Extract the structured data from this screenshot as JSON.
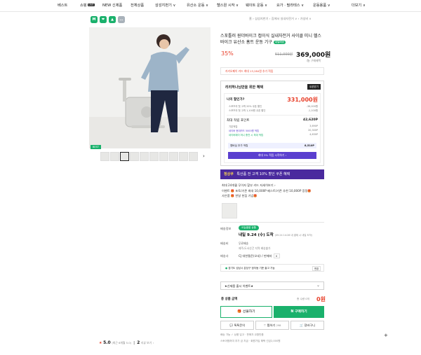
{
  "nav": {
    "items": [
      "베스트",
      "쇼핑",
      "NEW 신제품",
      "전체상품",
      "삼성지펀기 ∨",
      "유산소 운동 ∨",
      "헬스원 시작 ∨",
      "근력 운동 ∨",
      "웨이트 운동 ∨",
      "요가 · 필라테스 ∨",
      "운동용품 ∨",
      "더보기 ∨"
    ],
    "live_badge": "LIVE"
  },
  "breadcrumb": "홈 › 삼성지펀기 › 집에서 실내자전거 ∨ › 가성비 ∨",
  "badges": [
    "M",
    "❤",
    "▲",
    "…"
  ],
  "main_image": {
    "alt": "product photo"
  },
  "best_tag": "BEST",
  "thumbnails": {
    "count": 10,
    "selected_index": 2,
    "next": "›"
  },
  "rating": {
    "score": "5.0",
    "score_note": "(최근 6개월 5.0)",
    "reviews": "2",
    "reviews_label": "리뷰 보기"
  },
  "product": {
    "title": "스포틀러 원더바이크 접이식 실내자전거 사이클 미니 헬스 바이크 유산소 홈트 운동 기구",
    "delivery_badge": "내일배송",
    "discount": "35%",
    "orig_price": "511,000원",
    "price": "369,000원",
    "price_sub": "🛍 구매혜택",
    "card_line": "카카오페이 카드 최대 13,284원 추가 적립"
  },
  "benefit": {
    "header": "리리하나님만을 위한 혜택",
    "coupon_btn": "쿠폰받기",
    "mybest_label": "나의 할인가?",
    "mybest_value": "331,000원",
    "mybest_rows": [
      {
        "label": "스포츠의 첫 고객 20% 쿠폰 할인",
        "value": "-36,000원"
      },
      {
        "label": "스포츠의 첫 고객 1,100원 쿠폰 할인",
        "value": "-1,100원"
      }
    ],
    "points_label": "최대 적립 포인트",
    "points_value": "42,620P",
    "points_rows": [
      {
        "label": "기본적립",
        "value": "3,690P"
      },
      {
        "label": "네이버 현대카드 5000원 적립",
        "value": "20,300P"
      },
      {
        "label": "네이버페이 머니 충전 시 최대 적립",
        "value": "4,630P"
      }
    ],
    "membership": "멤버십 추가 적립",
    "membership_value": "8,510P",
    "cta": "최대 3% 적립 시작하기 ›"
  },
  "promo": {
    "accent": "정상쿠",
    "text": "특산품 전 고객 10% 할인 쿠폰 혜택"
  },
  "events": [
    "최대 24개월 무이자 할부 카드   자세히보기 ›",
    "이벤트  🎁 포토/기존 최대 10,000P 베스트/기존 추천 10,000P 증정🎁",
    "사은품  🎁 한달 헌집 기념🎁"
  ],
  "shipping": {
    "label": "배송정보",
    "today_badge": "오늘출발 상품",
    "arrival": "내일 9.24 (수) 도착",
    "arrival_note": "(09.24 14:28 내 결제 시 내일 도착)",
    "fee_label": "배송비",
    "fee": "무료배송",
    "fee_note": "제주/도서산간 지역 배송불가",
    "method_label": "배송사",
    "seller": "CJ 대한통운(오네) / 판매자",
    "map": "경기도 성남시 분당구 정자동 기준 출고 가능",
    "map_btn": "변경"
  },
  "option_select": "★신제품 출시 이벤트★",
  "total": {
    "label": "총 상품 금액",
    "count": "총 수량 0개",
    "amount": "0원"
  },
  "buttons": {
    "gift": "선물하기",
    "buy": "구매하기",
    "qa": "톡톡문의",
    "wish": "찜하기",
    "wish_count": "298",
    "cart": "장바구니"
  },
  "footer": [
    "배송 가능 ✓ 상품 입고 · 판매자 교환반품",
    "스토어찜하여 추가 금 지급 · 회원가입 혜택 선금2,000원"
  ],
  "colors": {
    "accent": "#1ab16c",
    "red": "#e8402a",
    "purple": "#4a2a9e"
  }
}
